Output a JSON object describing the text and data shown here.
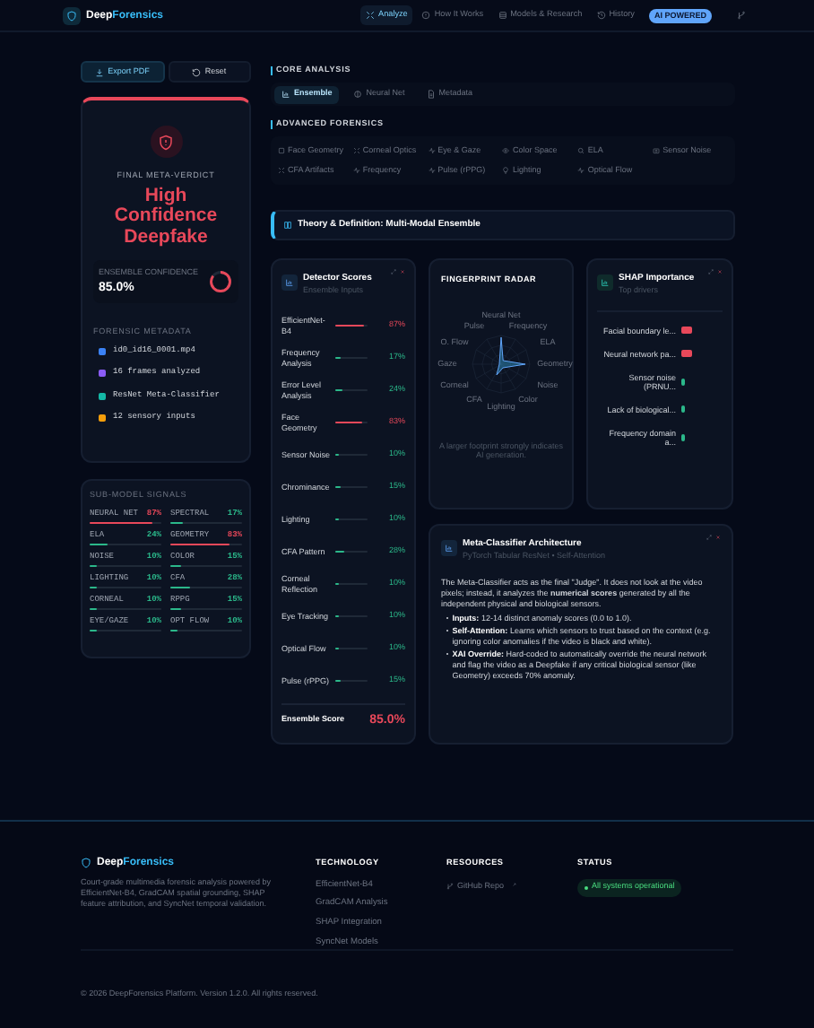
{
  "header": {
    "brand_first": "Deep",
    "brand_second": "Forensics",
    "nav": [
      {
        "label": "Analyze",
        "selected": true
      },
      {
        "label": "How It Works",
        "selected": false
      },
      {
        "label": "Models & Research",
        "selected": false
      },
      {
        "label": "History",
        "selected": false
      }
    ],
    "badge": "AI POWERED"
  },
  "actions": [
    {
      "label": "Export PDF",
      "kind": "primary"
    },
    {
      "label": "Reset",
      "kind": "secondary"
    }
  ],
  "verdict": {
    "label": "FINAL META-VERDICT",
    "title": "High Confidence Deepfake",
    "confidence_label": "ENSEMBLE CONFIDENCE",
    "confidence": "85.0%",
    "level": 0.85
  },
  "metadata": {
    "title": "FORENSIC METADATA",
    "items": [
      {
        "text": "id0_id16_0001.mp4",
        "color": "#3b82f6"
      },
      {
        "text": "16 frames analyzed",
        "color": "#8b5cf6"
      },
      {
        "text": "ResNet Meta-Classifier",
        "color": "#14b8a6"
      },
      {
        "text": "12 sensory inputs",
        "color": "#f59e0b"
      }
    ]
  },
  "sub_model_signals": {
    "title": "SUB-MODEL SIGNALS",
    "items": [
      {
        "name": "NEURAL NET",
        "value": "87%",
        "level": 0.87,
        "color": "#e8485a"
      },
      {
        "name": "SPECTRAL",
        "value": "17%",
        "level": 0.17,
        "color": "#2bb88a"
      },
      {
        "name": "ELA",
        "value": "24%",
        "level": 0.24,
        "color": "#2bb88a"
      },
      {
        "name": "GEOMETRY",
        "value": "83%",
        "level": 0.83,
        "color": "#e8485a"
      },
      {
        "name": "NOISE",
        "value": "10%",
        "level": 0.1,
        "color": "#2bb88a"
      },
      {
        "name": "COLOR",
        "value": "15%",
        "level": 0.15,
        "color": "#2bb88a"
      },
      {
        "name": "LIGHTING",
        "value": "10%",
        "level": 0.1,
        "color": "#2bb88a"
      },
      {
        "name": "CFA",
        "value": "28%",
        "level": 0.28,
        "color": "#2bb88a"
      },
      {
        "name": "CORNEAL",
        "value": "10%",
        "level": 0.1,
        "color": "#2bb88a"
      },
      {
        "name": "RPPG",
        "value": "15%",
        "level": 0.15,
        "color": "#2bb88a"
      },
      {
        "name": "EYE/GAZE",
        "value": "10%",
        "level": 0.1,
        "color": "#2bb88a"
      },
      {
        "name": "OPT FLOW",
        "value": "10%",
        "level": 0.1,
        "color": "#2bb88a"
      }
    ]
  },
  "core_analysis": {
    "title": "CORE ANALYSIS",
    "tabs": [
      {
        "label": "Ensemble",
        "selected": true
      },
      {
        "label": "Neural Net",
        "selected": false
      },
      {
        "label": "Metadata",
        "selected": false
      }
    ]
  },
  "advanced_forensics": {
    "title": "ADVANCED FORENSICS",
    "tools": [
      {
        "label": "Face Geometry"
      },
      {
        "label": "Corneal Optics"
      },
      {
        "label": "Eye & Gaze"
      },
      {
        "label": "Color Space"
      },
      {
        "label": "ELA"
      },
      {
        "label": "Sensor Noise"
      },
      {
        "label": "CFA Artifacts"
      },
      {
        "label": "Frequency"
      },
      {
        "label": "Pulse (rPPG)"
      },
      {
        "label": "Lighting"
      },
      {
        "label": "Optical Flow"
      }
    ]
  },
  "theory_banner": "Theory & Definition: Multi-Modal Ensemble",
  "detector_scores": {
    "title": "Detector Scores",
    "subtitle": "Ensemble Inputs",
    "rows": [
      {
        "name": "EfficientNet-B4",
        "value": "87%",
        "level": 0.87,
        "color": "#e8485a"
      },
      {
        "name": "Frequency Analysis",
        "value": "17%",
        "level": 0.17,
        "color": "#2bb88a"
      },
      {
        "name": "Error Level Analysis",
        "value": "24%",
        "level": 0.24,
        "color": "#2bb88a"
      },
      {
        "name": "Face Geometry",
        "value": "83%",
        "level": 0.83,
        "color": "#e8485a"
      },
      {
        "name": "Sensor Noise",
        "value": "10%",
        "level": 0.1,
        "color": "#2bb88a"
      },
      {
        "name": "Chrominance",
        "value": "15%",
        "level": 0.15,
        "color": "#2bb88a"
      },
      {
        "name": "Lighting",
        "value": "10%",
        "level": 0.1,
        "color": "#2bb88a"
      },
      {
        "name": "CFA Pattern",
        "value": "28%",
        "level": 0.28,
        "color": "#2bb88a"
      },
      {
        "name": "Corneal Reflection",
        "value": "10%",
        "level": 0.1,
        "color": "#2bb88a"
      },
      {
        "name": "Eye Tracking",
        "value": "10%",
        "level": 0.1,
        "color": "#2bb88a"
      },
      {
        "name": "Optical Flow",
        "value": "10%",
        "level": 0.1,
        "color": "#2bb88a"
      },
      {
        "name": "Pulse (rPPG)",
        "value": "15%",
        "level": 0.15,
        "color": "#2bb88a"
      }
    ],
    "total_label": "Ensemble Score",
    "total": "85.0%"
  },
  "radar": {
    "title": "FINGERPRINT RADAR",
    "labels": [
      "Neural Net",
      "Pulse",
      "Frequency",
      "O. Flow",
      "ELA",
      "Gaze",
      "Geometry",
      "Corneal",
      "Noise",
      "CFA",
      "Color",
      "Lighting"
    ],
    "caption": "A larger footprint strongly indicates AI generation."
  },
  "shap": {
    "title": "SHAP Importance",
    "subtitle": "Top drivers",
    "features": [
      {
        "label": "Facial boundary le...",
        "kind": "strong",
        "color": "#e8485a"
      },
      {
        "label": "Neural network pa...",
        "kind": "strong",
        "color": "#e8485a"
      },
      {
        "label": "Sensor noise (PRNU...",
        "kind": "weak",
        "color": "#2bb88a"
      },
      {
        "label": "Lack of biological...",
        "kind": "weak",
        "color": "#2bb88a"
      },
      {
        "label": "Frequency domain a...",
        "kind": "weak",
        "color": "#2bb88a"
      }
    ]
  },
  "meta_classifier": {
    "title": "Meta-Classifier Architecture",
    "subtitle": "PyTorch Tabular ResNet • Self-Attention",
    "intro": "The Meta-Classifier acts as the final \"Judge\". It does not look at the video pixels; instead, it analyzes the **numerical scores** generated by all the independent physical and biological sensors.",
    "bullets": [
      {
        "term": "Inputs:",
        "text": "12-14 distinct anomaly scores (0.0 to 1.0)."
      },
      {
        "term": "Self-Attention:",
        "text": "Learns which sensors to trust based on the context (e.g. ignoring color anomalies if the video is black and white)."
      },
      {
        "term": "XAI Override:",
        "text": "Hard-coded to automatically override the neural network and flag the video as a Deepfake if any critical biological sensor (like Geometry) exceeds 70% anomaly."
      }
    ]
  },
  "footer": {
    "brand_first": "Deep",
    "brand_second": "Forensics",
    "description": "Court-grade multimedia forensic analysis powered by EfficientNet-B4, GradCAM spatial grounding, SHAP feature attribution, and SyncNet temporal validation.",
    "columns": [
      {
        "title": "TECHNOLOGY",
        "kind": "list",
        "items": [
          "EfficientNet-B4",
          "GradCAM Analysis",
          "SHAP Integration",
          "SyncNet Models"
        ]
      },
      {
        "title": "RESOURCES",
        "kind": "links",
        "items": [
          "GitHub Repo"
        ]
      },
      {
        "title": "STATUS",
        "kind": "status",
        "items": [
          "All systems operational"
        ]
      }
    ],
    "copyright": "© 2026 DeepForensics Platform. Version 1.2.0. All rights reserved."
  }
}
